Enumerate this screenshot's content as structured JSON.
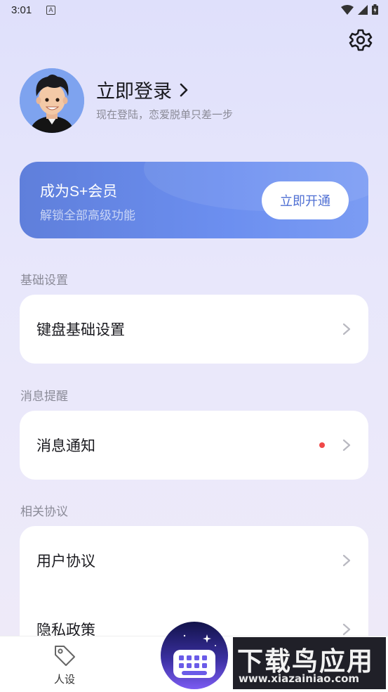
{
  "status_bar": {
    "time": "3:01",
    "notification_icon_letter": "A"
  },
  "header": {
    "settings_icon": "gear-icon"
  },
  "profile": {
    "title": "立即登录",
    "subtitle": "现在登陆，恋爱脱单只差一步"
  },
  "vip": {
    "title": "成为S+会员",
    "subtitle": "解锁全部高级功能",
    "button_label": "立即开通"
  },
  "sections": {
    "basic": {
      "label": "基础设置",
      "items": [
        {
          "label": "键盘基础设置"
        }
      ]
    },
    "notify": {
      "label": "消息提醒",
      "items": [
        {
          "label": "消息通知",
          "has_dot": true
        }
      ]
    },
    "agreement": {
      "label": "相关协议",
      "items": [
        {
          "label": "用户协议"
        },
        {
          "label": "隐私政策"
        }
      ]
    }
  },
  "tabbar": {
    "persona_label": "人设"
  },
  "watermark": {
    "title": "下载鸟应用",
    "url": "www.xiazainiao.com"
  },
  "colors": {
    "accent": "#6a8cee",
    "red_dot": "#f04848",
    "bg": "#e4e3fb"
  }
}
